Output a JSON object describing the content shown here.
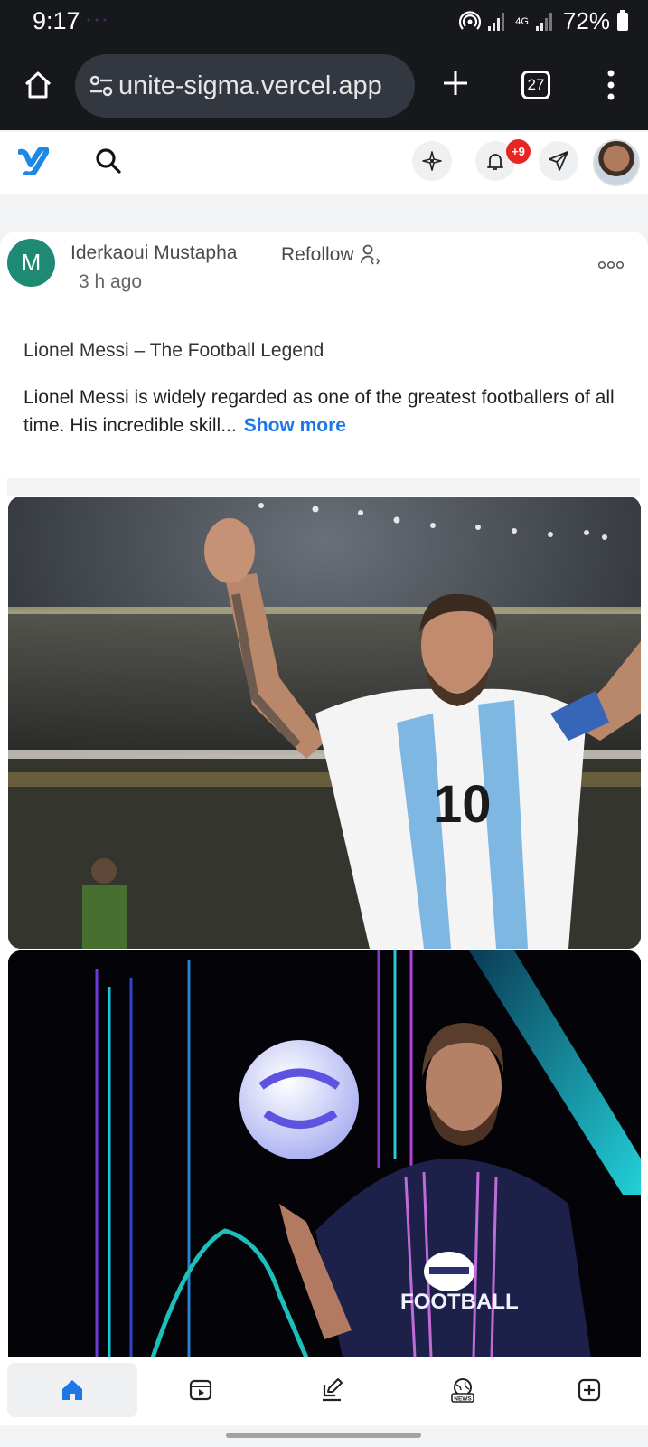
{
  "status_bar": {
    "time": "9:17",
    "network": "4G",
    "battery": "72%"
  },
  "browser": {
    "url": "unite-sigma.vercel.app",
    "tab_count": "27"
  },
  "app_header": {
    "notification_badge": "+9",
    "accent_color": "#1d78e6"
  },
  "post": {
    "avatar_initial": "M",
    "author": "Iderkaoui Mustapha",
    "refollow_label": "Refollow",
    "time_ago": "3 h ago",
    "title": "Lionel Messi – The Football Legend",
    "body": "Lionel Messi is widely regarded as one of the greatest footballers of all time. His incredible skill...",
    "show_more": "Show more",
    "images": [
      {
        "kind": "photo",
        "subject": "messi-celebrating-argentina-10"
      },
      {
        "kind": "photo",
        "subject": "messi-efootball-promo"
      }
    ],
    "image2_text": "FOOTBALL"
  },
  "bottom_nav": {
    "items": [
      {
        "icon": "home-icon",
        "active": true
      },
      {
        "icon": "reels-icon",
        "active": false
      },
      {
        "icon": "edit-icon",
        "active": false
      },
      {
        "icon": "news-icon",
        "active": false
      },
      {
        "icon": "add-post-icon",
        "active": false
      }
    ],
    "news_label": "NEWS"
  }
}
